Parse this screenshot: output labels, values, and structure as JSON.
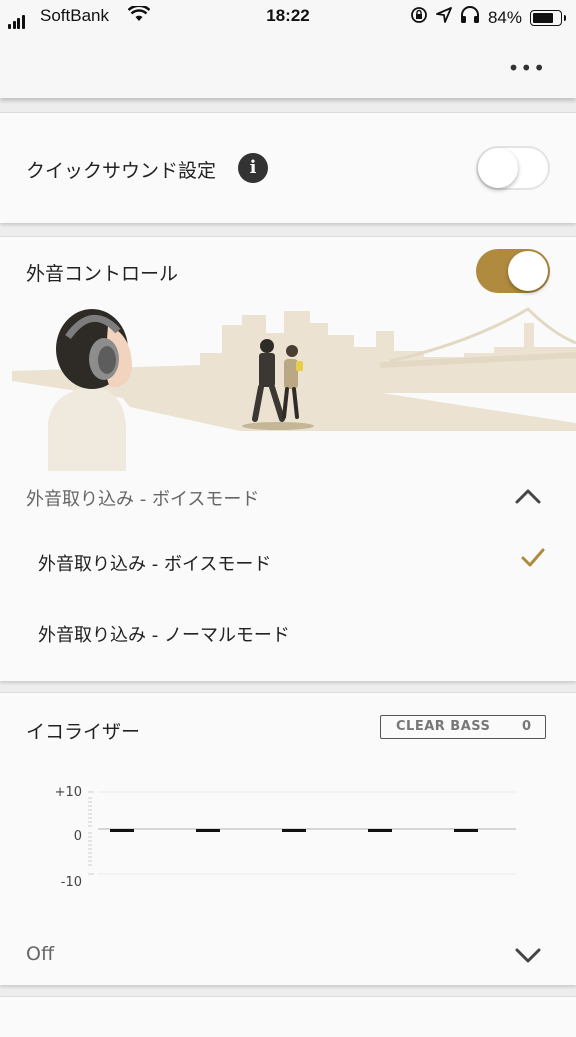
{
  "status_bar": {
    "carrier": "SoftBank",
    "time": "18:22",
    "battery": "84%",
    "battery_level": 0.84
  },
  "nav": {
    "more_label": "•••"
  },
  "quick_sound": {
    "label": "クイックサウンド設定",
    "info_glyph": "i",
    "enabled": false
  },
  "ambient": {
    "title": "外音コントロール",
    "enabled": true,
    "current_mode": "外音取り込み - ボイスモード",
    "options": [
      {
        "label": "外音取り込み - ボイスモード",
        "selected": true
      },
      {
        "label": "外音取り込み - ノーマルモード",
        "selected": false
      }
    ]
  },
  "equalizer": {
    "title": "イコライザー",
    "clear_bass_label": "CLEAR BASS",
    "clear_bass_value": "0",
    "ticks": [
      "+10",
      "0",
      "-10"
    ],
    "band_values": [
      0,
      0,
      0,
      0,
      0
    ],
    "preset": "Off"
  },
  "colors": {
    "accent": "#b08a3e",
    "illustration": "#ece3d3"
  }
}
